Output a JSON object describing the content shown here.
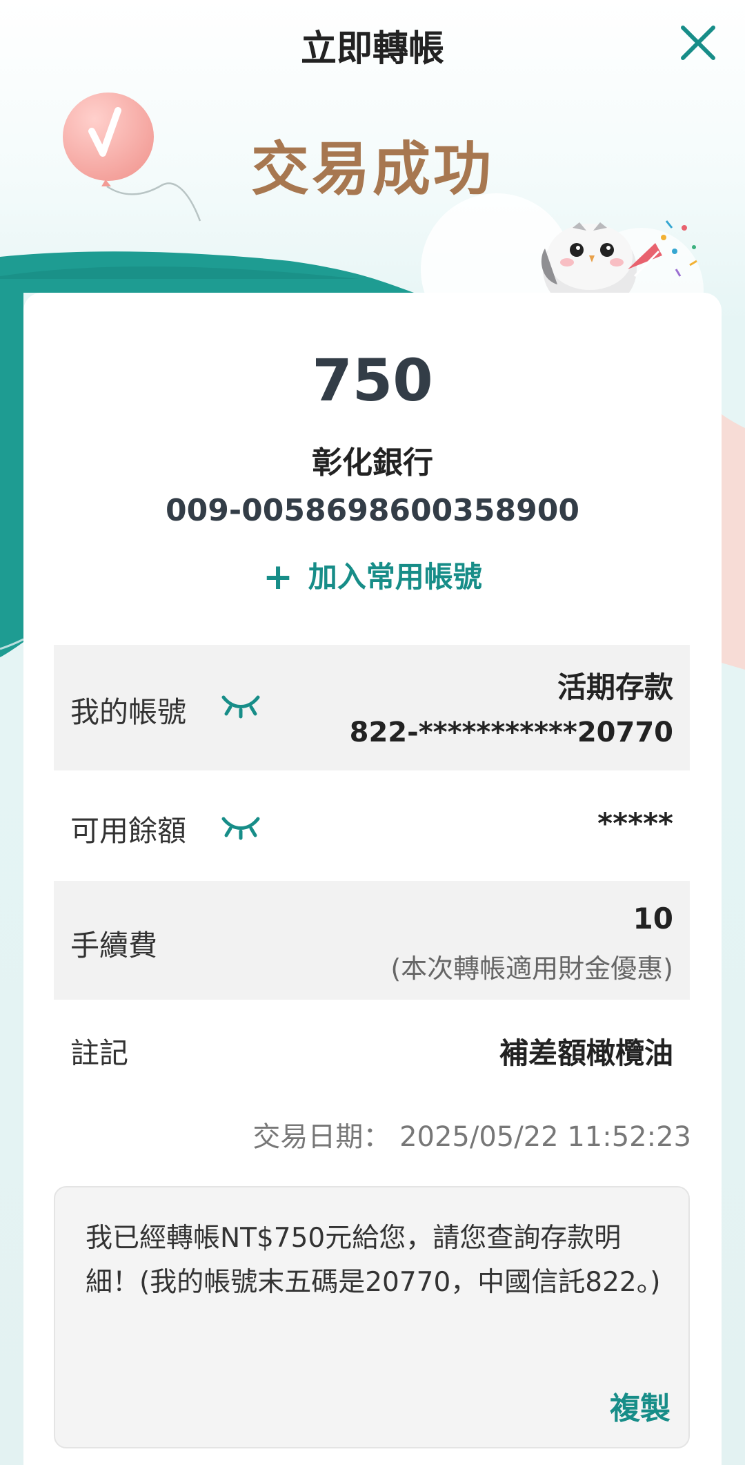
{
  "header": {
    "title": "立即轉帳",
    "close_icon": "close-icon"
  },
  "banner": {
    "title": "交易成功",
    "balloon_icon": "check-balloon-icon",
    "mascot_icon": "owl-party-icon",
    "colors": {
      "teal": "#178d88",
      "brown": "#a77750"
    }
  },
  "transfer": {
    "amount": "750",
    "bank_name": "彰化銀行",
    "account": "009-0058698600358900",
    "add_favorite_label": "加入常用帳號"
  },
  "details": {
    "my_account": {
      "label": "我的帳號",
      "type": "活期存款",
      "number": "822-***********20770"
    },
    "balance": {
      "label": "可用餘額",
      "value": "*****"
    },
    "fee": {
      "label": "手續費",
      "value": "10",
      "note": "(本次轉帳適用財金優惠)"
    },
    "memo": {
      "label": "註記",
      "value": "補差額橄欖油"
    }
  },
  "transaction_date": "交易日期： 2025/05/22 11:52:23",
  "message": {
    "text": "我已經轉帳NT$750元給您，請您查詢存款明細！(我的帳號末五碼是20770，中國信託822。)",
    "copy_label": "複製"
  }
}
